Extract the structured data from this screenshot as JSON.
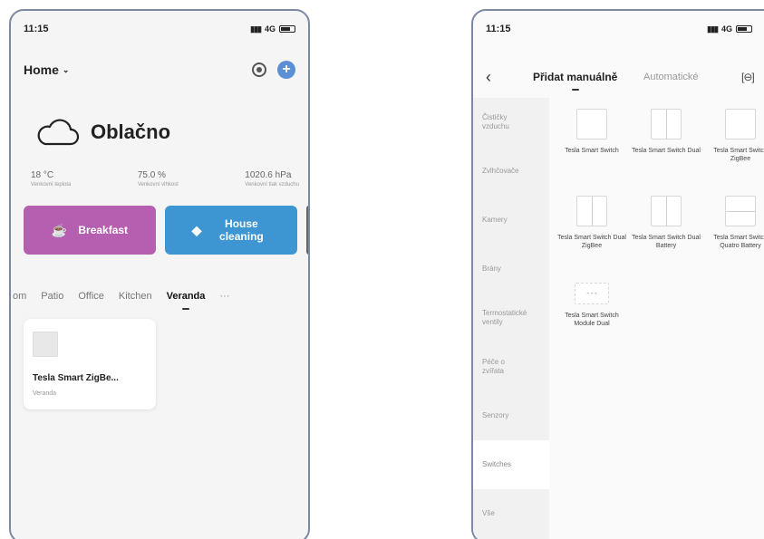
{
  "left_phone": {
    "status": {
      "time": "11:15",
      "network": "4G"
    },
    "header": {
      "title": "Home",
      "chevron": "chevron-down-icon"
    },
    "weather": {
      "condition": "Oblačno",
      "icon": "cloud-icon",
      "stats": [
        {
          "value": "18 °C",
          "label": "Venkovní teplota"
        },
        {
          "value": "75.0 %",
          "label": "Venkovní vlhkost"
        },
        {
          "value": "1020.6 hPa",
          "label": "Venkovní tlak vzduchu"
        }
      ]
    },
    "scenes": [
      {
        "label": "Breakfast",
        "icon": "coffee-icon",
        "color": "#b65fb0"
      },
      {
        "label": "House cleaning",
        "icon": "tag-icon",
        "color": "#3d95d2"
      }
    ],
    "rooms": [
      "om",
      "Patio",
      "Office",
      "Kitchen",
      "Veranda"
    ],
    "active_room": "Veranda",
    "more": "···",
    "device": {
      "name": "Tesla Smart ZigBe...",
      "room": "Veranda"
    }
  },
  "right_phone": {
    "status": {
      "time": "11:15",
      "network": "4G"
    },
    "tabs": {
      "manual": "Přidat manuálně",
      "auto": "Automatické"
    },
    "categories": [
      "Čističky vzduchu",
      "Zvlhčovače",
      "Kamery",
      "Brány",
      "Termostatické ventily",
      "Péče o zvířata",
      "Senzory",
      "Switches",
      "Vše"
    ],
    "active_category": "Switches",
    "devices": [
      {
        "name": "Tesla Smart Switch",
        "thumb": "single"
      },
      {
        "name": "Tesla Smart Switch Dual",
        "thumb": "dual"
      },
      {
        "name": "Tesla Smart Switch ZigBee",
        "thumb": "single"
      },
      {
        "name": "Tesla Smart Switch Dual ZigBee",
        "thumb": "dual"
      },
      {
        "name": "Tesla Smart Switch Dual Battery",
        "thumb": "dual"
      },
      {
        "name": "Tesla Smart Switch Quatro Battery",
        "thumb": "quad"
      },
      {
        "name": "Tesla Smart Switch Module Dual",
        "thumb": "module"
      }
    ]
  }
}
